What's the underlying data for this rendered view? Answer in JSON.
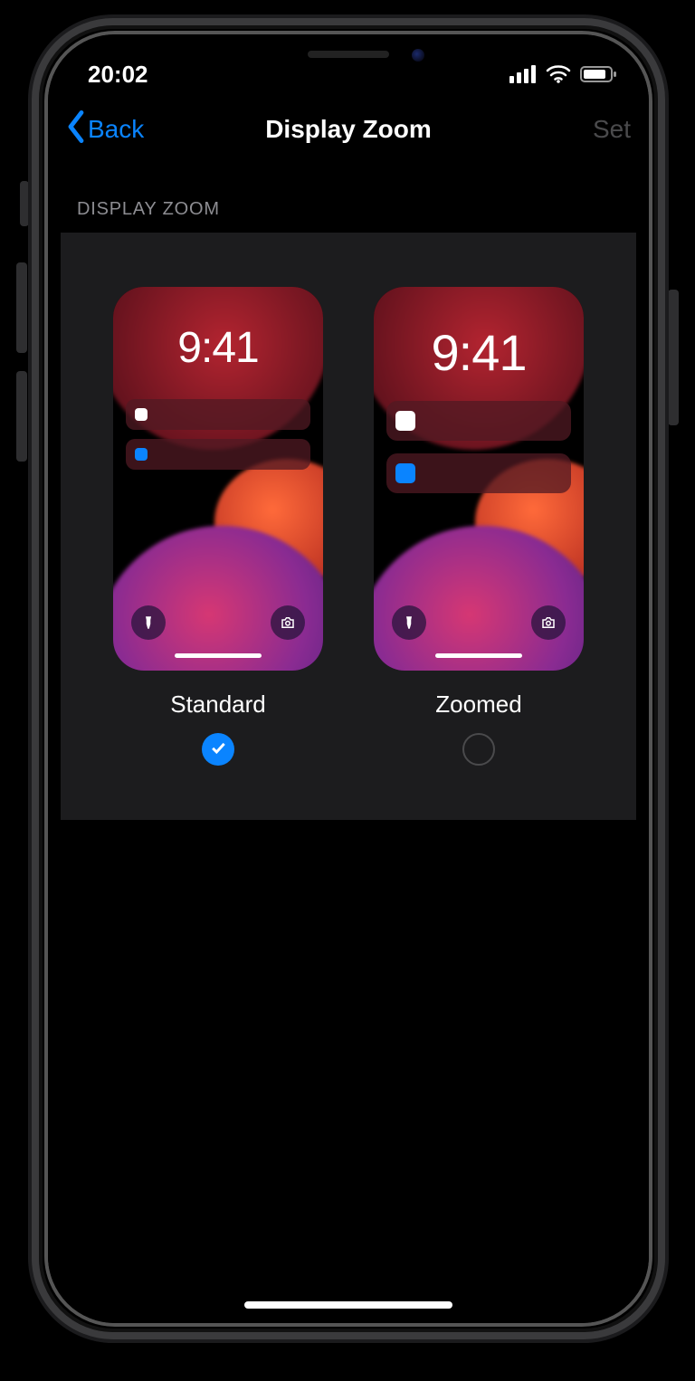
{
  "status": {
    "time": "20:02"
  },
  "nav": {
    "back_label": "Back",
    "title": "Display Zoom",
    "set_label": "Set"
  },
  "section": {
    "header": "DISPLAY ZOOM"
  },
  "options": {
    "standard": {
      "label": "Standard",
      "preview_time": "9:41",
      "selected": true
    },
    "zoomed": {
      "label": "Zoomed",
      "preview_time": "9:41",
      "selected": false
    }
  },
  "colors": {
    "accent": "#0a84ff",
    "panel_bg": "#1c1c1e",
    "muted_text": "#8d8d92",
    "disabled_text": "#4a4a4c"
  }
}
